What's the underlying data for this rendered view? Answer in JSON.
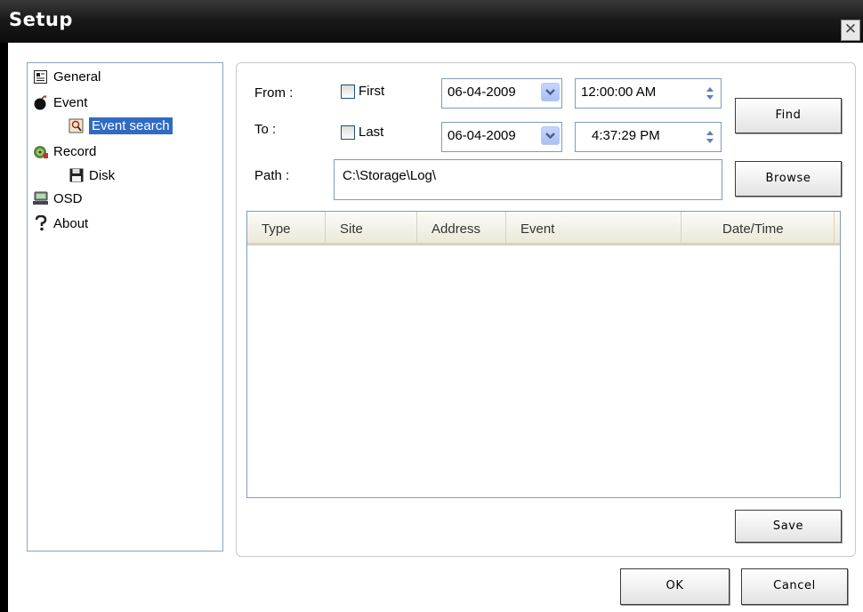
{
  "window": {
    "title": "Setup",
    "close_glyph": "✕"
  },
  "tree": {
    "items": [
      {
        "label": "General",
        "icon": "general-icon"
      },
      {
        "label": "Event",
        "icon": "bomb-icon"
      },
      {
        "label": "Event search",
        "icon": "event-search-icon",
        "selected": true
      },
      {
        "label": "Record",
        "icon": "record-icon"
      },
      {
        "label": "Disk",
        "icon": "floppy-disk-icon"
      },
      {
        "label": "OSD",
        "icon": "osd-icon"
      },
      {
        "label": "About",
        "icon": "about-icon"
      }
    ]
  },
  "search": {
    "from_label": "From :",
    "to_label": "To :",
    "first_label": "First",
    "last_label": "Last",
    "first_checked": false,
    "last_checked": false,
    "from_date": "06-04-2009",
    "to_date": "06-04-2009",
    "from_time": "12:00:00 AM",
    "to_time": "4:37:29 PM",
    "path_label": "Path :",
    "path_value": "C:\\Storage\\Log\\"
  },
  "buttons": {
    "find": "Find",
    "browse": "Browse",
    "save": "Save",
    "ok": "OK",
    "cancel": "Cancel"
  },
  "table": {
    "columns": [
      "Type",
      "Site",
      "Address",
      "Event",
      "Date/Time"
    ],
    "rows": []
  },
  "colors": {
    "titlebar": "#1a1a1a",
    "selection": "#316ac5",
    "dropdown_button": "#b5c9f5",
    "field_border": "#7f9db9"
  }
}
